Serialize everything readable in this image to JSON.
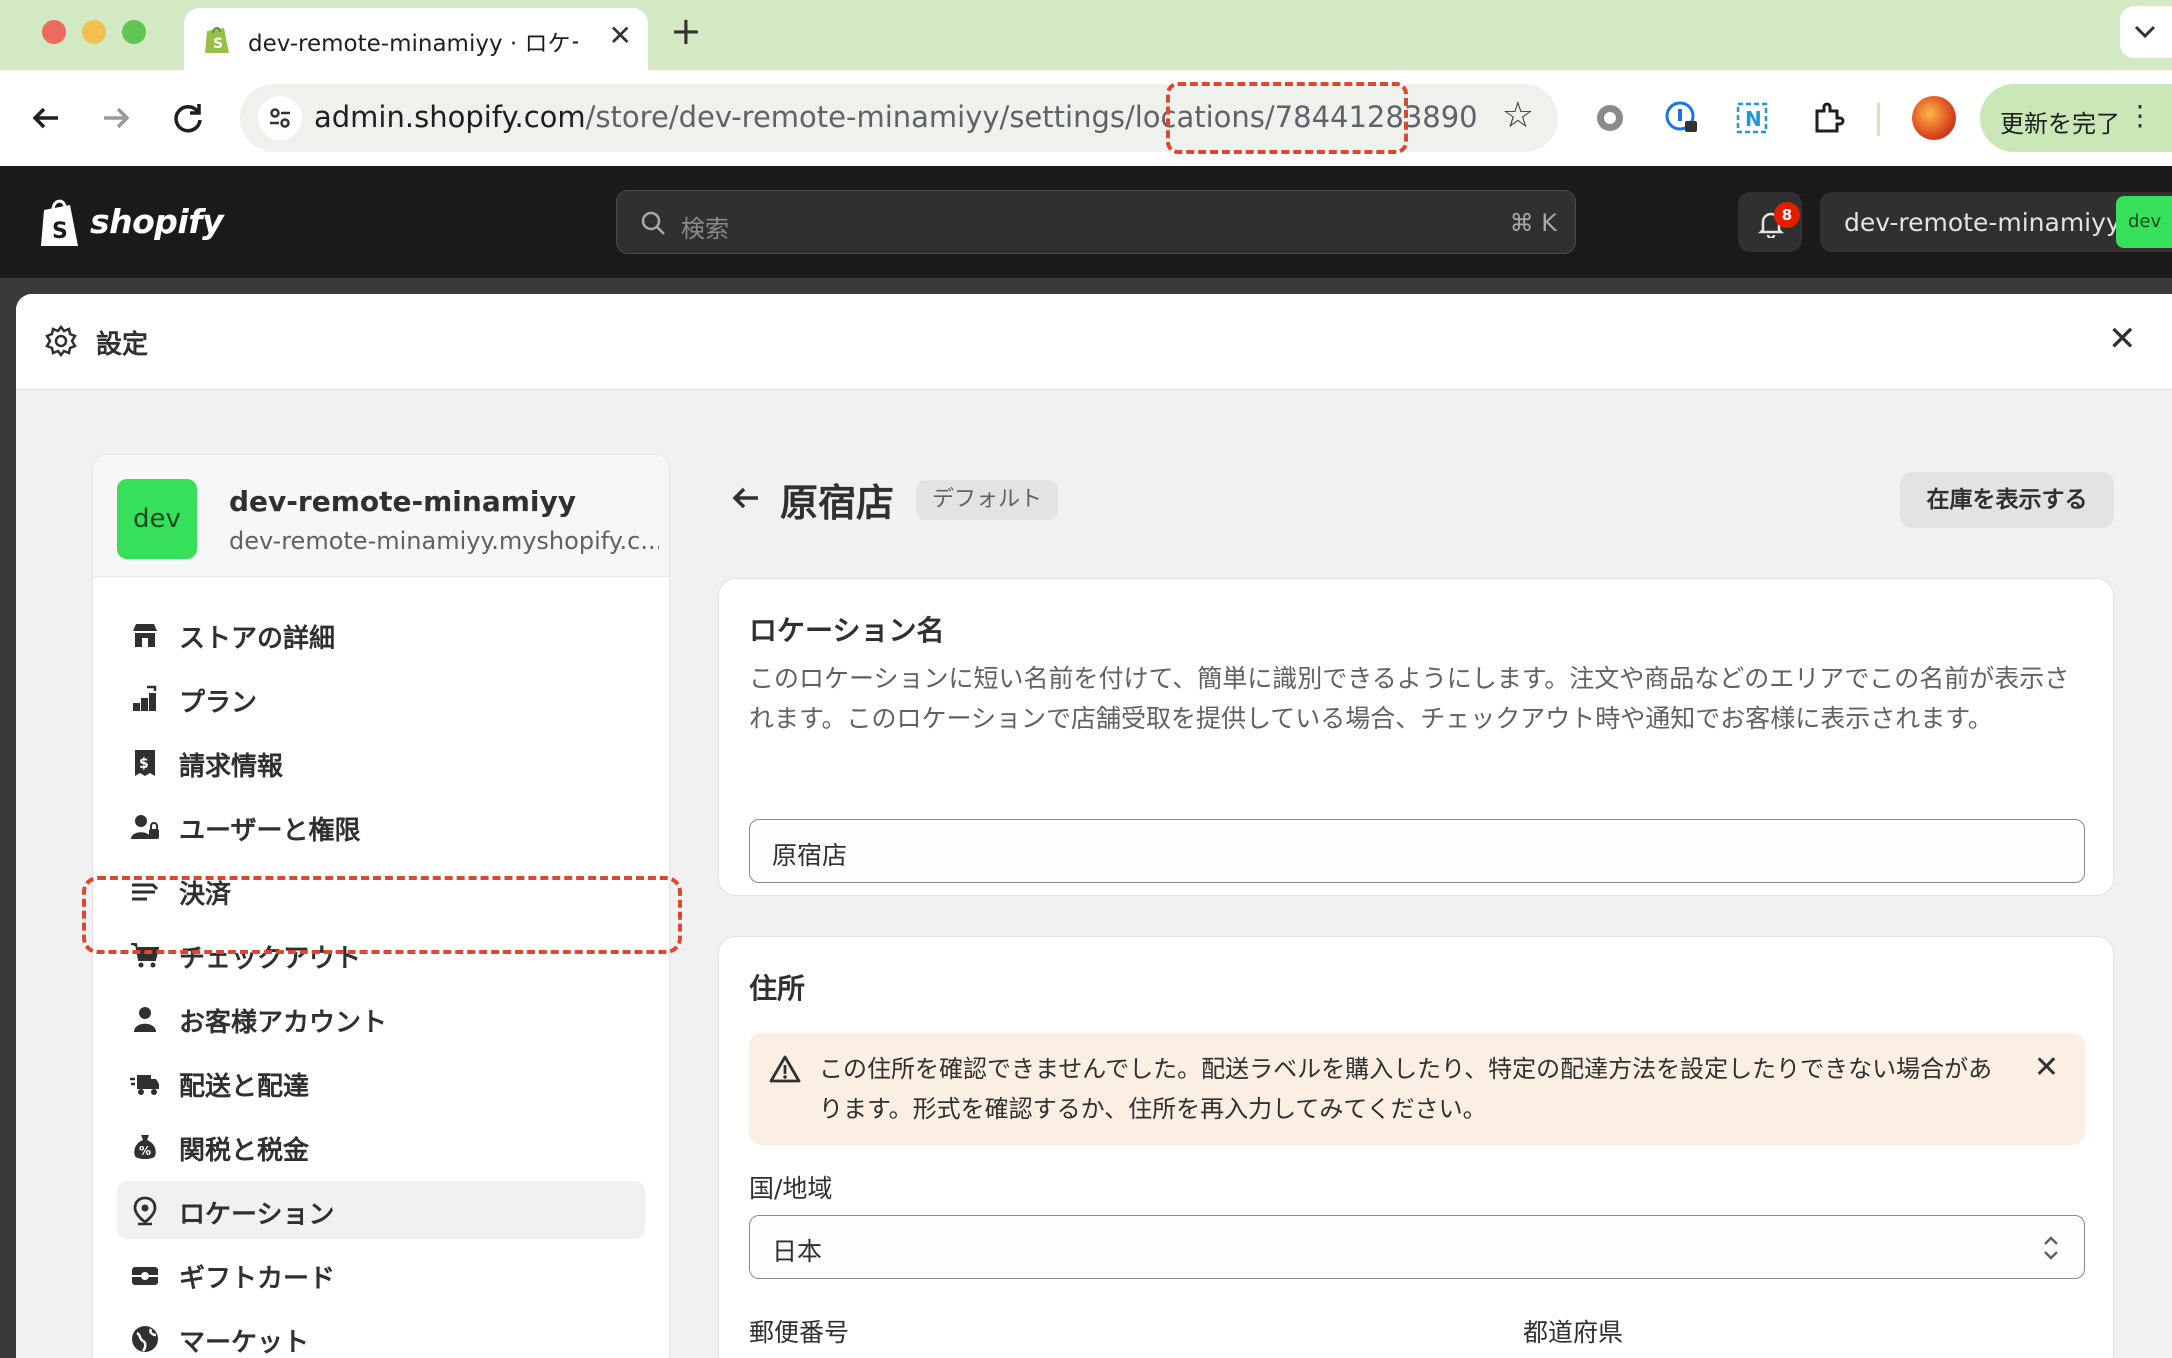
{
  "browser": {
    "tab_title": "dev-remote-minamiyy · ロケーション",
    "url_host": "admin.shopify.com",
    "url_path": "/store/dev-remote-minamiyy/settings/locations/78441283890",
    "update_button": "更新を完了"
  },
  "header": {
    "logo_text": "shopify",
    "search_placeholder": "検索",
    "search_shortcut": "⌘ K",
    "notification_count": "8",
    "store_name": "dev-remote-minamiyy",
    "store_avatar": "dev"
  },
  "settings": {
    "title": "設定"
  },
  "sidebar": {
    "avatar": "dev",
    "store_name": "dev-remote-minamiyy",
    "store_domain": "dev-remote-minamiyy.myshopify.c...",
    "items": [
      {
        "label": "ストアの詳細",
        "icon": "store-icon"
      },
      {
        "label": "プラン",
        "icon": "plan-icon"
      },
      {
        "label": "請求情報",
        "icon": "billing-icon"
      },
      {
        "label": "ユーザーと権限",
        "icon": "users-icon"
      },
      {
        "label": "決済",
        "icon": "payments-icon"
      },
      {
        "label": "チェックアウト",
        "icon": "cart-icon"
      },
      {
        "label": "お客様アカウント",
        "icon": "person-icon"
      },
      {
        "label": "配送と配達",
        "icon": "truck-icon"
      },
      {
        "label": "関税と税金",
        "icon": "tax-icon"
      },
      {
        "label": "ロケーション",
        "icon": "location-pin-icon"
      },
      {
        "label": "ギフトカード",
        "icon": "gift-card-icon"
      },
      {
        "label": "マーケット",
        "icon": "globe-icon"
      }
    ]
  },
  "page": {
    "title": "原宿店",
    "badge": "デフォルト",
    "inventory_button": "在庫を表示する"
  },
  "location_card": {
    "title": "ロケーション名",
    "description": "このロケーションに短い名前を付けて、簡単に識別できるようにします。注文や商品などのエリアでこの名前が表示されます。このロケーションで店舗受取を提供している場合、チェックアウト時や通知でお客様に表示されます。",
    "name_value": "原宿店"
  },
  "address_card": {
    "title": "住所",
    "warning": "この住所を確認できませんでした。配送ラベルを購入したり、特定の配達方法を設定したりできない場合があります。形式を確認するか、住所を再入力してみてください。",
    "country_label": "国/地域",
    "country_value": "日本",
    "postal_label": "郵便番号",
    "prefecture_label": "都道府県"
  }
}
